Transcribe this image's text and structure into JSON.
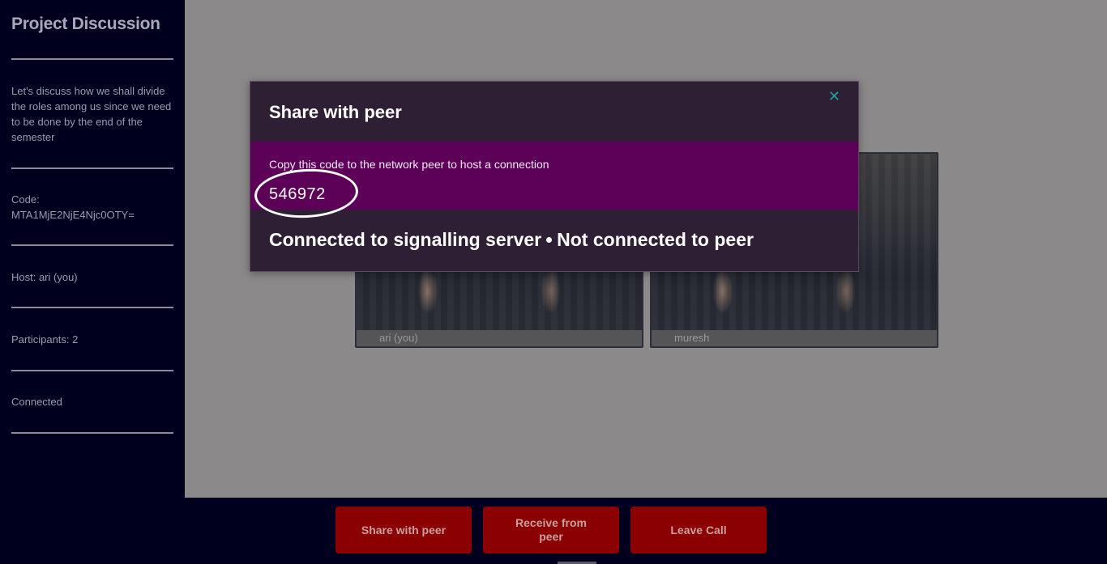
{
  "sidebar": {
    "title": "Project Discussion",
    "description": "Let's discuss how we shall divide the roles among us since we need to be done by the end of the semester",
    "code_label": "Code:",
    "code_value": "MTA1MjE2NjE4Njc0OTY=",
    "host": "Host: ari (you)",
    "participants": "Participants: 2",
    "connection_status": "Connected"
  },
  "videos": [
    {
      "name": "ari (you)"
    },
    {
      "name": "muresh"
    }
  ],
  "dialog": {
    "title": "Share with peer",
    "close_icon": "close-icon",
    "instruction": "Copy this code to the network peer to host a connection",
    "code": "546972",
    "status_server": "Connected to signalling server",
    "status_peer": "Not connected to peer"
  },
  "bottombar": {
    "share_label": "Share with peer",
    "receive_label": "Receive from peer",
    "leave_label": "Leave Call"
  },
  "colors": {
    "sidebar_bg": "#00001e",
    "stage_bg": "#8b8989",
    "dialog_bg": "#2e1f34",
    "dialog_band": "#5c0058",
    "button_bg": "#8b0000",
    "close_accent": "#1aa39c"
  }
}
